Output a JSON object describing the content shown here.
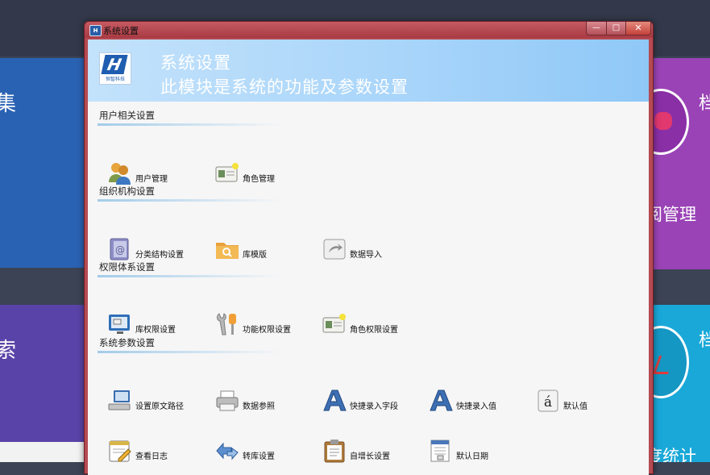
{
  "background": {
    "left_top_char": "集",
    "left_bottom_char": "索",
    "right_top_char": "档",
    "right_mid_label": "阅管理",
    "right_bottom_char": "档",
    "right_bottom_label": "度统计"
  },
  "window": {
    "app_icon": "H",
    "title": "系统设置",
    "minimize": "—",
    "maximize": "□",
    "close": "✕"
  },
  "banner": {
    "logo_mark": "H",
    "logo_text": "恒智科技",
    "title": "系统设置",
    "subtitle": "此模块是系统的功能及参数设置"
  },
  "sections": [
    {
      "title": "用户相关设置",
      "items": [
        {
          "label": "用户管理",
          "icon": "users-icon"
        },
        {
          "label": "角色管理",
          "icon": "id-card-icon"
        }
      ]
    },
    {
      "title": "组织机构设置",
      "items": [
        {
          "label": "分类结构设置",
          "icon": "address-book-icon"
        },
        {
          "label": "库模版",
          "icon": "folder-search-icon"
        },
        {
          "label": "数据导入",
          "icon": "import-arrow-icon"
        }
      ]
    },
    {
      "title": "权限体系设置",
      "items": [
        {
          "label": "库权限设置",
          "icon": "monitor-window-icon"
        },
        {
          "label": "功能权限设置",
          "icon": "wrench-icon"
        },
        {
          "label": "角色权限设置",
          "icon": "id-card-icon"
        }
      ]
    },
    {
      "title": "系统参数设置",
      "items": [
        {
          "label": "设置原文路径",
          "icon": "network-computer-icon"
        },
        {
          "label": "数据参照",
          "icon": "printer-icon"
        },
        {
          "label": "快捷录入字段",
          "icon": "letter-a-icon"
        },
        {
          "label": "快捷录入值",
          "icon": "letter-a-icon"
        },
        {
          "label": "默认值",
          "icon": "letter-a-acute-icon"
        },
        {
          "label": "查看日志",
          "icon": "notepad-pencil-icon"
        },
        {
          "label": "转库设置",
          "icon": "transfer-arrows-icon"
        },
        {
          "label": "自增长设置",
          "icon": "clipboard-icon"
        },
        {
          "label": "默认日期",
          "icon": "document-calendar-icon"
        }
      ]
    }
  ],
  "colors": {
    "accent_blue": "#1f5db0",
    "window_frame": "#b54a52",
    "banner": "#a9d5fa"
  }
}
